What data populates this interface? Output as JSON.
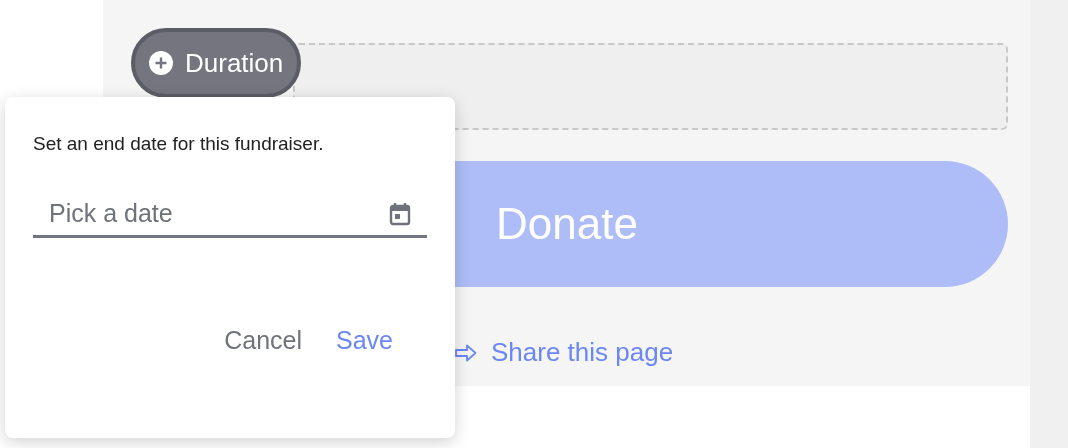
{
  "duration_chip": {
    "label": "Duration"
  },
  "donate_button": {
    "label": "Donate"
  },
  "share_link": {
    "label": "Share this page"
  },
  "popover": {
    "message": "Set an end date for this fundraiser.",
    "date_field": {
      "placeholder": "Pick a date"
    },
    "buttons": [
      {
        "label": "Cancel",
        "kind": "secondary"
      },
      {
        "label": "Save",
        "kind": "primary"
      }
    ]
  }
}
